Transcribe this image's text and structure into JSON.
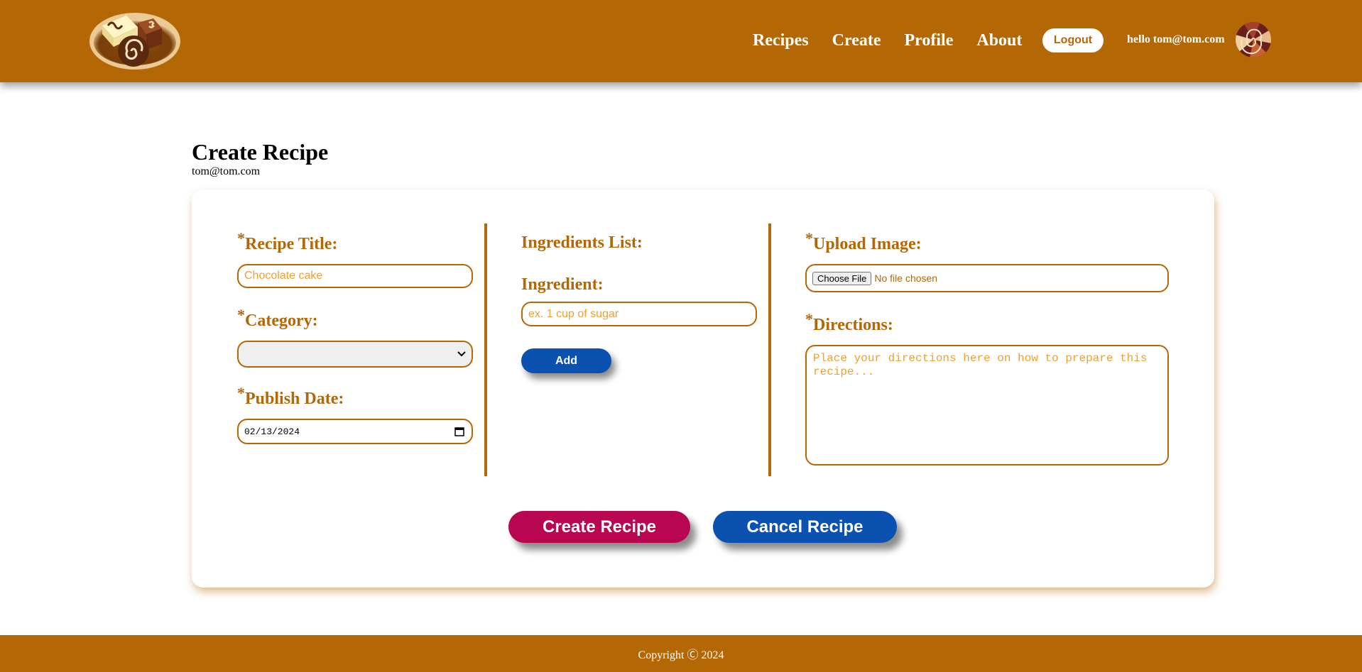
{
  "header": {
    "logo_icon": "chocolate-candies-logo",
    "nav": [
      {
        "label": "Recipes"
      },
      {
        "label": "Create"
      },
      {
        "label": "Profile"
      },
      {
        "label": "About"
      }
    ],
    "logout_label": "Logout",
    "greeting": "hello tom@tom.com",
    "avatar_icon": "chocolate-swirl-avatar"
  },
  "page": {
    "title": "Create Recipe",
    "user_email": "tom@tom.com"
  },
  "form": {
    "required_marker": "*",
    "recipe_title_label": "Recipe Title:",
    "recipe_title_placeholder": "Chocolate cake",
    "category_label": "Category:",
    "category_value": "",
    "publish_date_label": "Publish Date:",
    "publish_date_value": "02/13/2024",
    "ingredients_list_label": "Ingredients List:",
    "ingredient_label": "Ingredient:",
    "ingredient_placeholder": "ex. 1 cup of sugar",
    "add_label": "Add",
    "upload_image_label": "Upload Image:",
    "choose_file_label": "Choose File",
    "no_file_text": "No file chosen",
    "directions_label": "Directions:",
    "directions_placeholder": "Place your directions here on how to prepare this recipe...",
    "create_label": "Create Recipe",
    "cancel_label": "Cancel Recipe"
  },
  "footer": {
    "copyright": "Copyright Ⓒ 2024"
  },
  "colors": {
    "brand": "#b36705",
    "primary_blue": "#0b51b0",
    "create_magenta": "#b80650",
    "placeholder_orange": "#f0a030"
  }
}
